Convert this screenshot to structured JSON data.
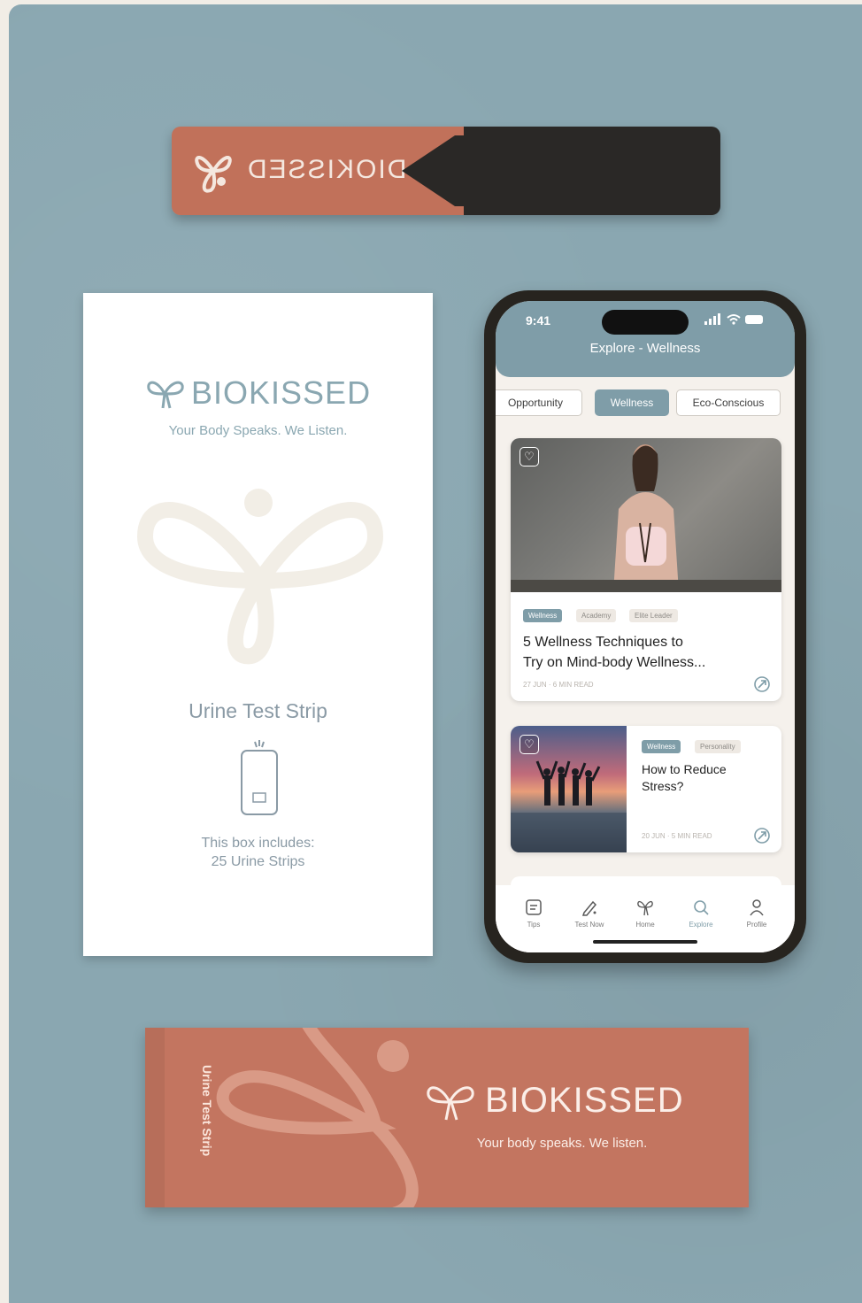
{
  "colors": {
    "background": "#8aa7b1",
    "terracotta": "#c1715a",
    "teal": "#7f9da8",
    "dark": "#2a2826",
    "cream": "#f5f1ec"
  },
  "strip": {
    "brand_mirrored": "DIOKISSED",
    "swatches": [
      [
        "#f4e8a6",
        "#8fc9a2",
        "#f6ef9e",
        "#2b7f87",
        "#f2b07a",
        "#dd9ac3"
      ],
      [
        "#d6ad7b",
        "#f7efb6",
        "#fbf5e3",
        "#c7322b",
        "#b8e06b",
        "#e7a23f"
      ]
    ]
  },
  "box": {
    "brand": "BIOKISSED",
    "tagline": "Your Body Speaks. We Listen.",
    "title": "Urine Test Strip",
    "includes_line1": "This box includes:",
    "includes_line2": "25 Urine Strips"
  },
  "sachet": {
    "vertical_label": "Urine Test Strip",
    "brand": "BIOKISSED",
    "tagline": "Your body speaks. We listen."
  },
  "phone": {
    "time": "9:41",
    "title": "Explore - Wellness",
    "tabs": [
      {
        "label": "Opportunity",
        "active": false
      },
      {
        "label": "Wellness",
        "active": true
      },
      {
        "label": "Eco-Conscious",
        "active": false
      }
    ],
    "articles": [
      {
        "tags": [
          "Wellness",
          "Academy",
          "Elite Leader"
        ],
        "title_line1": "5 Wellness Techniques to",
        "title_line2": "Try on Mind-body Wellness...",
        "meta": "27 JUN · 6 MIN READ"
      },
      {
        "tags": [
          "Wellness",
          "Personality"
        ],
        "title_line1": "How to Reduce",
        "title_line2": "Stress?",
        "meta": "20 JUN · 5 MIN READ"
      }
    ],
    "nav": [
      {
        "label": "Tips",
        "icon": "tips-icon"
      },
      {
        "label": "Test Now",
        "icon": "pen-icon"
      },
      {
        "label": "Home",
        "icon": "butterfly-icon"
      },
      {
        "label": "Explore",
        "icon": "search-icon",
        "active": true
      },
      {
        "label": "Profile",
        "icon": "profile-icon"
      }
    ]
  }
}
